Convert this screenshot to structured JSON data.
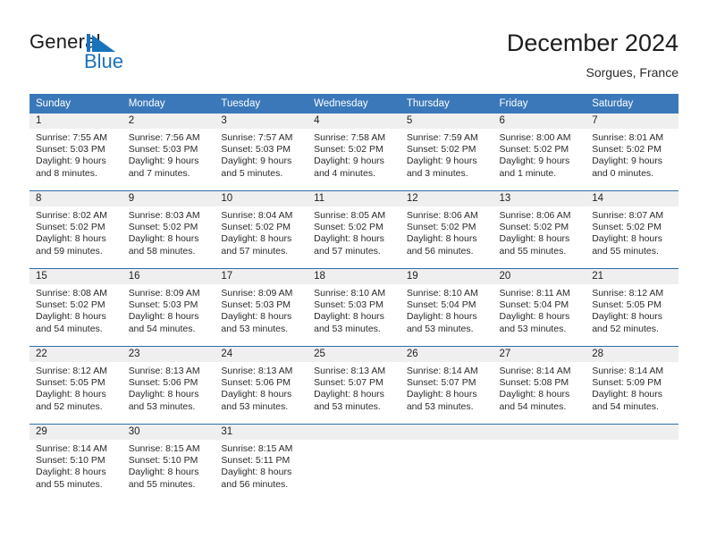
{
  "brand": {
    "name_top": "General",
    "name_bottom": "Blue",
    "mark": "triangle-logo",
    "accent_color": "#1a72ba"
  },
  "header": {
    "title": "December 2024",
    "subtitle": "Sorgues, France"
  },
  "calendar": {
    "header_color": "#3b78b9",
    "daynum_band_color": "#efefef",
    "weekday_headers": [
      "Sunday",
      "Monday",
      "Tuesday",
      "Wednesday",
      "Thursday",
      "Friday",
      "Saturday"
    ],
    "weeks": [
      [
        {
          "day": "1",
          "sunrise": "Sunrise: 7:55 AM",
          "sunset": "Sunset: 5:03 PM",
          "daylight_1": "Daylight: 9 hours",
          "daylight_2": "and 8 minutes."
        },
        {
          "day": "2",
          "sunrise": "Sunrise: 7:56 AM",
          "sunset": "Sunset: 5:03 PM",
          "daylight_1": "Daylight: 9 hours",
          "daylight_2": "and 7 minutes."
        },
        {
          "day": "3",
          "sunrise": "Sunrise: 7:57 AM",
          "sunset": "Sunset: 5:03 PM",
          "daylight_1": "Daylight: 9 hours",
          "daylight_2": "and 5 minutes."
        },
        {
          "day": "4",
          "sunrise": "Sunrise: 7:58 AM",
          "sunset": "Sunset: 5:02 PM",
          "daylight_1": "Daylight: 9 hours",
          "daylight_2": "and 4 minutes."
        },
        {
          "day": "5",
          "sunrise": "Sunrise: 7:59 AM",
          "sunset": "Sunset: 5:02 PM",
          "daylight_1": "Daylight: 9 hours",
          "daylight_2": "and 3 minutes."
        },
        {
          "day": "6",
          "sunrise": "Sunrise: 8:00 AM",
          "sunset": "Sunset: 5:02 PM",
          "daylight_1": "Daylight: 9 hours",
          "daylight_2": "and 1 minute."
        },
        {
          "day": "7",
          "sunrise": "Sunrise: 8:01 AM",
          "sunset": "Sunset: 5:02 PM",
          "daylight_1": "Daylight: 9 hours",
          "daylight_2": "and 0 minutes."
        }
      ],
      [
        {
          "day": "8",
          "sunrise": "Sunrise: 8:02 AM",
          "sunset": "Sunset: 5:02 PM",
          "daylight_1": "Daylight: 8 hours",
          "daylight_2": "and 59 minutes."
        },
        {
          "day": "9",
          "sunrise": "Sunrise: 8:03 AM",
          "sunset": "Sunset: 5:02 PM",
          "daylight_1": "Daylight: 8 hours",
          "daylight_2": "and 58 minutes."
        },
        {
          "day": "10",
          "sunrise": "Sunrise: 8:04 AM",
          "sunset": "Sunset: 5:02 PM",
          "daylight_1": "Daylight: 8 hours",
          "daylight_2": "and 57 minutes."
        },
        {
          "day": "11",
          "sunrise": "Sunrise: 8:05 AM",
          "sunset": "Sunset: 5:02 PM",
          "daylight_1": "Daylight: 8 hours",
          "daylight_2": "and 57 minutes."
        },
        {
          "day": "12",
          "sunrise": "Sunrise: 8:06 AM",
          "sunset": "Sunset: 5:02 PM",
          "daylight_1": "Daylight: 8 hours",
          "daylight_2": "and 56 minutes."
        },
        {
          "day": "13",
          "sunrise": "Sunrise: 8:06 AM",
          "sunset": "Sunset: 5:02 PM",
          "daylight_1": "Daylight: 8 hours",
          "daylight_2": "and 55 minutes."
        },
        {
          "day": "14",
          "sunrise": "Sunrise: 8:07 AM",
          "sunset": "Sunset: 5:02 PM",
          "daylight_1": "Daylight: 8 hours",
          "daylight_2": "and 55 minutes."
        }
      ],
      [
        {
          "day": "15",
          "sunrise": "Sunrise: 8:08 AM",
          "sunset": "Sunset: 5:02 PM",
          "daylight_1": "Daylight: 8 hours",
          "daylight_2": "and 54 minutes."
        },
        {
          "day": "16",
          "sunrise": "Sunrise: 8:09 AM",
          "sunset": "Sunset: 5:03 PM",
          "daylight_1": "Daylight: 8 hours",
          "daylight_2": "and 54 minutes."
        },
        {
          "day": "17",
          "sunrise": "Sunrise: 8:09 AM",
          "sunset": "Sunset: 5:03 PM",
          "daylight_1": "Daylight: 8 hours",
          "daylight_2": "and 53 minutes."
        },
        {
          "day": "18",
          "sunrise": "Sunrise: 8:10 AM",
          "sunset": "Sunset: 5:03 PM",
          "daylight_1": "Daylight: 8 hours",
          "daylight_2": "and 53 minutes."
        },
        {
          "day": "19",
          "sunrise": "Sunrise: 8:10 AM",
          "sunset": "Sunset: 5:04 PM",
          "daylight_1": "Daylight: 8 hours",
          "daylight_2": "and 53 minutes."
        },
        {
          "day": "20",
          "sunrise": "Sunrise: 8:11 AM",
          "sunset": "Sunset: 5:04 PM",
          "daylight_1": "Daylight: 8 hours",
          "daylight_2": "and 53 minutes."
        },
        {
          "day": "21",
          "sunrise": "Sunrise: 8:12 AM",
          "sunset": "Sunset: 5:05 PM",
          "daylight_1": "Daylight: 8 hours",
          "daylight_2": "and 52 minutes."
        }
      ],
      [
        {
          "day": "22",
          "sunrise": "Sunrise: 8:12 AM",
          "sunset": "Sunset: 5:05 PM",
          "daylight_1": "Daylight: 8 hours",
          "daylight_2": "and 52 minutes."
        },
        {
          "day": "23",
          "sunrise": "Sunrise: 8:13 AM",
          "sunset": "Sunset: 5:06 PM",
          "daylight_1": "Daylight: 8 hours",
          "daylight_2": "and 53 minutes."
        },
        {
          "day": "24",
          "sunrise": "Sunrise: 8:13 AM",
          "sunset": "Sunset: 5:06 PM",
          "daylight_1": "Daylight: 8 hours",
          "daylight_2": "and 53 minutes."
        },
        {
          "day": "25",
          "sunrise": "Sunrise: 8:13 AM",
          "sunset": "Sunset: 5:07 PM",
          "daylight_1": "Daylight: 8 hours",
          "daylight_2": "and 53 minutes."
        },
        {
          "day": "26",
          "sunrise": "Sunrise: 8:14 AM",
          "sunset": "Sunset: 5:07 PM",
          "daylight_1": "Daylight: 8 hours",
          "daylight_2": "and 53 minutes."
        },
        {
          "day": "27",
          "sunrise": "Sunrise: 8:14 AM",
          "sunset": "Sunset: 5:08 PM",
          "daylight_1": "Daylight: 8 hours",
          "daylight_2": "and 54 minutes."
        },
        {
          "day": "28",
          "sunrise": "Sunrise: 8:14 AM",
          "sunset": "Sunset: 5:09 PM",
          "daylight_1": "Daylight: 8 hours",
          "daylight_2": "and 54 minutes."
        }
      ],
      [
        {
          "day": "29",
          "sunrise": "Sunrise: 8:14 AM",
          "sunset": "Sunset: 5:10 PM",
          "daylight_1": "Daylight: 8 hours",
          "daylight_2": "and 55 minutes."
        },
        {
          "day": "30",
          "sunrise": "Sunrise: 8:15 AM",
          "sunset": "Sunset: 5:10 PM",
          "daylight_1": "Daylight: 8 hours",
          "daylight_2": "and 55 minutes."
        },
        {
          "day": "31",
          "sunrise": "Sunrise: 8:15 AM",
          "sunset": "Sunset: 5:11 PM",
          "daylight_1": "Daylight: 8 hours",
          "daylight_2": "and 56 minutes."
        },
        {
          "day": "",
          "sunrise": "",
          "sunset": "",
          "daylight_1": "",
          "daylight_2": ""
        },
        {
          "day": "",
          "sunrise": "",
          "sunset": "",
          "daylight_1": "",
          "daylight_2": ""
        },
        {
          "day": "",
          "sunrise": "",
          "sunset": "",
          "daylight_1": "",
          "daylight_2": ""
        },
        {
          "day": "",
          "sunrise": "",
          "sunset": "",
          "daylight_1": "",
          "daylight_2": ""
        }
      ]
    ]
  }
}
